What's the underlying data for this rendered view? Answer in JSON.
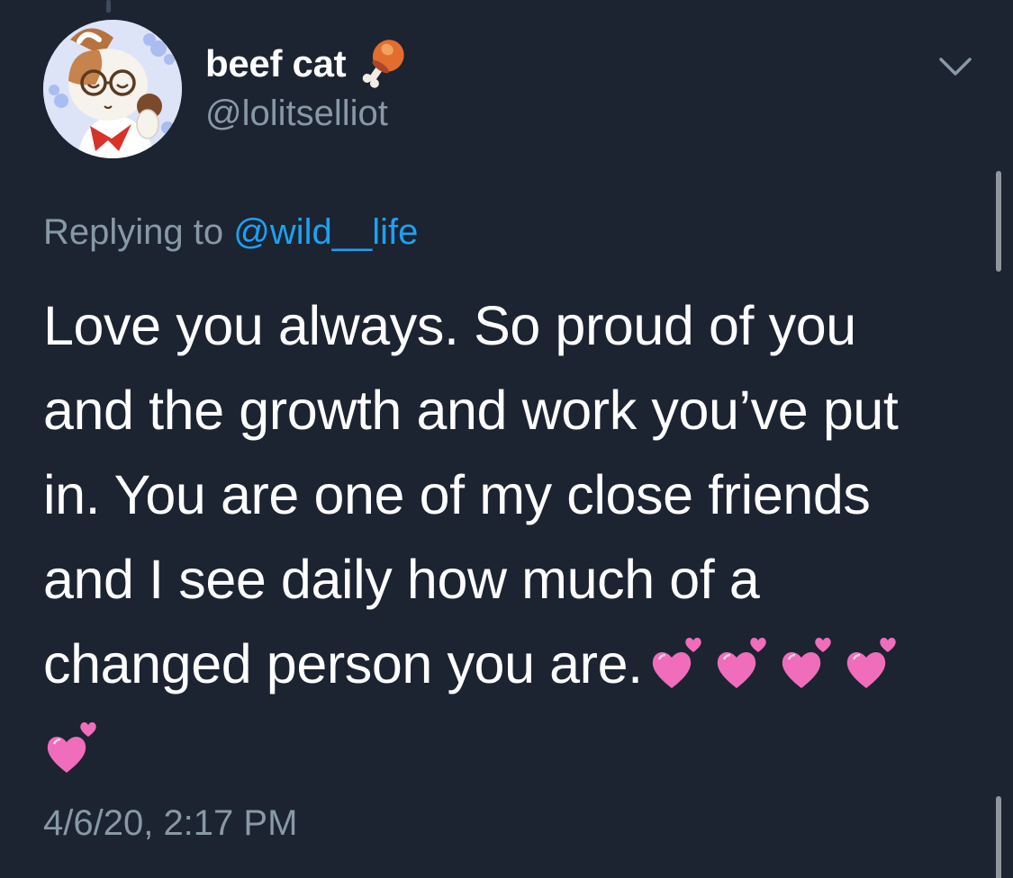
{
  "author": {
    "display_name": "beef cat",
    "handle": "@lolitselliot",
    "name_icon": "meat-on-bone-icon",
    "avatar": "cartoon-dog-avatar"
  },
  "reply": {
    "prefix": "Replying to",
    "mention": "@wild__life"
  },
  "tweet": {
    "lines": [
      "Love you always. So proud of you",
      "and the growth and work you’ve put",
      "in. You are one of my close friends",
      "and I see daily how much of a",
      "changed person you are."
    ],
    "emoji": "two-hearts-emoji",
    "emoji_count": 5
  },
  "timestamp": "4/6/20, 2:17 PM",
  "icons": {
    "more": "chevron-down-icon"
  },
  "colors": {
    "background": "#1c2331",
    "primary_text": "#ffffff",
    "secondary_text": "#8899a6",
    "link": "#1da1f2",
    "heart": "#f06dbb"
  }
}
